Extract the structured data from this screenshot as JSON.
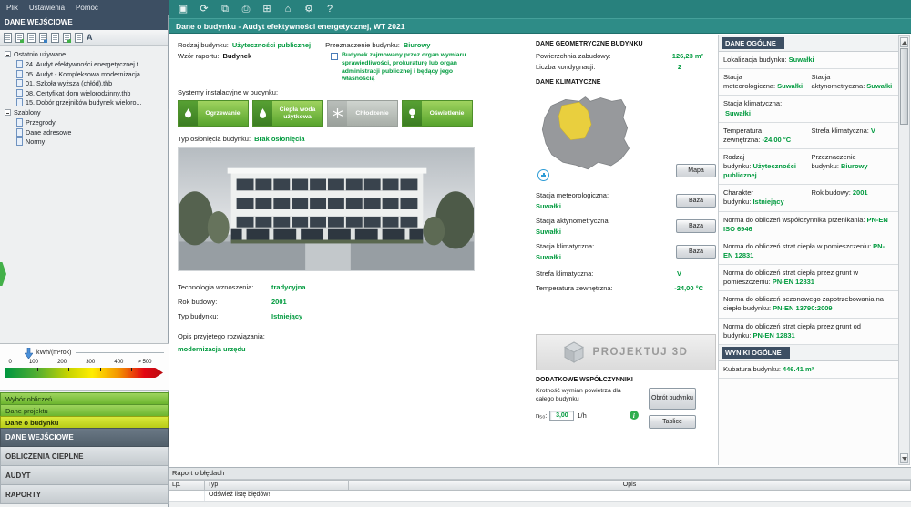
{
  "colors": {
    "accent_green": "#009a3e",
    "toolbar_teal": "#28817d",
    "header_dark": "#3d4f63",
    "nav_selected": "#c3d62c"
  },
  "menubar": {
    "items": [
      "Plik",
      "Ustawienia",
      "Pomoc"
    ]
  },
  "toolbar": {
    "title": "Dane o budynku - Audyt efektywności energetycznej, WT 2021",
    "icons": [
      {
        "name": "save-icon",
        "glyph": "▣"
      },
      {
        "name": "refresh-icon",
        "glyph": "⟳"
      },
      {
        "name": "save-all-icon",
        "glyph": "⧉"
      },
      {
        "name": "print-icon",
        "glyph": "⎙"
      },
      {
        "name": "calculator-icon",
        "glyph": "⊞"
      },
      {
        "name": "home-icon",
        "glyph": "⌂"
      },
      {
        "name": "settings-icon",
        "glyph": "⚙"
      },
      {
        "name": "help-icon",
        "glyph": "?"
      }
    ]
  },
  "sidebar": {
    "header": "DANE WEJŚCIOWE",
    "format_icon": "A",
    "tree": {
      "recent_label": "Ostatnio używane",
      "recent_items": [
        "24. Audyt efektywności energetycznej.t...",
        "05. Audyt - Kompleksowa modernizacja...",
        "01. Szkoła wyższa (chłód).thb",
        "08. Certyfikat dom wielorodzinny.thb",
        "15. Dobór grzejników budynek wieloro..."
      ],
      "templates_label": "Szablony",
      "template_items": [
        "Przegrody",
        "Dane adresowe",
        "Normy"
      ]
    },
    "energy_scale": {
      "unit": "kWh/(m²rok)",
      "ticks": [
        "0",
        "100",
        "200",
        "300",
        "400",
        "> 500"
      ]
    },
    "nav_items": [
      {
        "label": "Wybór obliczeń"
      },
      {
        "label": "Dane projektu"
      },
      {
        "label": "Dane o budynku"
      },
      {
        "label": "DANE WEJŚCIOWE"
      },
      {
        "label": "OBLICZENIA CIEPLNE"
      },
      {
        "label": "AUDYT"
      },
      {
        "label": "RAPORTY"
      }
    ]
  },
  "form": {
    "rodzaj_label": "Rodzaj budynku:",
    "rodzaj_value": "Użyteczności publicznej",
    "wzor_label": "Wzór raportu:",
    "wzor_value": "Budynek",
    "przeznaczenie_label": "Przeznaczenie budynku:",
    "przeznaczenie_value": "Biurowy",
    "checkbox_text": "Budynek zajmowany przez organ wymiaru sprawiedliwości, prokuraturę lub organ administracji publicznej i będący jego własnością",
    "systemy_label": "Systemy instalacyjne w budynku:",
    "systems": [
      {
        "label": "Ogrzewanie",
        "active": true
      },
      {
        "label": "Ciepła woda użytkowa",
        "active": true
      },
      {
        "label": "Chłodzenie",
        "active": false
      },
      {
        "label": "Oświetlenie",
        "active": true
      }
    ],
    "oslona_label": "Typ osłonięcia budynku:",
    "oslona_value": "Brak osłonięcia",
    "technologia_label": "Technologia wznoszenia:",
    "technologia_value": "tradycyjna",
    "rok_label": "Rok budowy:",
    "rok_value": "2001",
    "typ_label": "Typ budynku:",
    "typ_value": "Istniejący",
    "opis_label": "Opis przyjętego rozwiązania:",
    "opis_value": "modernizacja urzędu"
  },
  "geometry": {
    "header": "DANE GEOMETRYCZNE BUDYNKU",
    "powierzchnia_label": "Powierzchnia zabudowy:",
    "powierzchnia_value": "126,23 m²",
    "kondygnacje_label": "Liczba kondygnacji:",
    "kondygnacje_value": "2"
  },
  "climate": {
    "header": "DANE KLIMATYCZNE",
    "mapa_button": "Mapa",
    "baza_button": "Baza",
    "stations": [
      {
        "label": "Stacja meteorologiczna:",
        "value": "Suwałki"
      },
      {
        "label": "Stacja aktynometryczna:",
        "value": "Suwałki"
      },
      {
        "label": "Stacja klimatyczna:",
        "value": "Suwałki"
      }
    ],
    "strefa_label": "Strefa klimatyczna:",
    "strefa_value": "V",
    "temperatura_label": "Temperatura zewnętrzna:",
    "temperatura_value": "-24,00 °C"
  },
  "projekt3d_label": "PROJEKTUJ 3D",
  "coefficients": {
    "header": "DODATKOWE WSPÓŁCZYNNIKI",
    "krotnosc_label": "Krotność wymian powietrza dla całego budynku",
    "n50_label": "n₅₀:",
    "n50_value": "3,00",
    "n50_unit": "1/h",
    "info_glyph": "i",
    "obrot_button": "Obrót budynku",
    "tablice_button": "Tablice"
  },
  "summary": {
    "header": "DANE OGÓLNE",
    "rows": [
      {
        "cells": [
          {
            "label": "Lokalizacja budynku:",
            "value": "Suwałki"
          }
        ]
      },
      {
        "cells": [
          {
            "label": "Stacja meteorologiczna:",
            "value": "Suwałki"
          },
          {
            "label": "Stacja aktynometryczna:",
            "value": "Suwałki"
          }
        ]
      },
      {
        "cells": [
          {
            "label": "Stacja klimatyczna:",
            "value": "Suwałki"
          }
        ]
      },
      {
        "cells": [
          {
            "label": "Temperatura zewnętrzna:",
            "value": "-24,00 °C"
          },
          {
            "label": "Strefa klimatyczna:",
            "value": "V"
          }
        ]
      },
      {
        "cells": [
          {
            "label": "Rodzaj budynku:",
            "value": "Użyteczności publicznej"
          },
          {
            "label": "Przeznaczenie budynku:",
            "value": "Biurowy"
          }
        ]
      },
      {
        "cells": [
          {
            "label": "Charakter budynku:",
            "value": "Istniejący"
          },
          {
            "label": "Rok budowy:",
            "value": "2001"
          }
        ]
      },
      {
        "cells": [
          {
            "label": "Norma do obliczeń współczynnika przenikania:",
            "value": "PN-EN ISO 6946"
          }
        ]
      },
      {
        "cells": [
          {
            "label": "Norma do obliczeń strat ciepła w pomieszczeniu:",
            "value": "PN-EN 12831"
          }
        ]
      },
      {
        "cells": [
          {
            "label": "Norma do obliczeń strat ciepła przez grunt w pomieszczeniu:",
            "value": "PN-EN 12831"
          }
        ]
      },
      {
        "cells": [
          {
            "label": "Norma do obliczeń sezonowego zapotrzebowania na ciepło budynku:",
            "value": "PN-EN 13790:2009"
          }
        ]
      },
      {
        "cells": [
          {
            "label": "Norma do obliczeń strat ciepła przez grunt od budynku:",
            "value": "PN-EN 12831"
          }
        ]
      }
    ],
    "wyniki_header": "WYNIKI OGÓLNE",
    "kubatura_label": "Kubatura budynku:",
    "kubatura_value": "446.41 m³"
  },
  "error_panel": {
    "header": "Raport o błędach",
    "columns": [
      "Lp.",
      "Typ",
      "Opis"
    ],
    "message": "Odśwież listę błędów!"
  }
}
